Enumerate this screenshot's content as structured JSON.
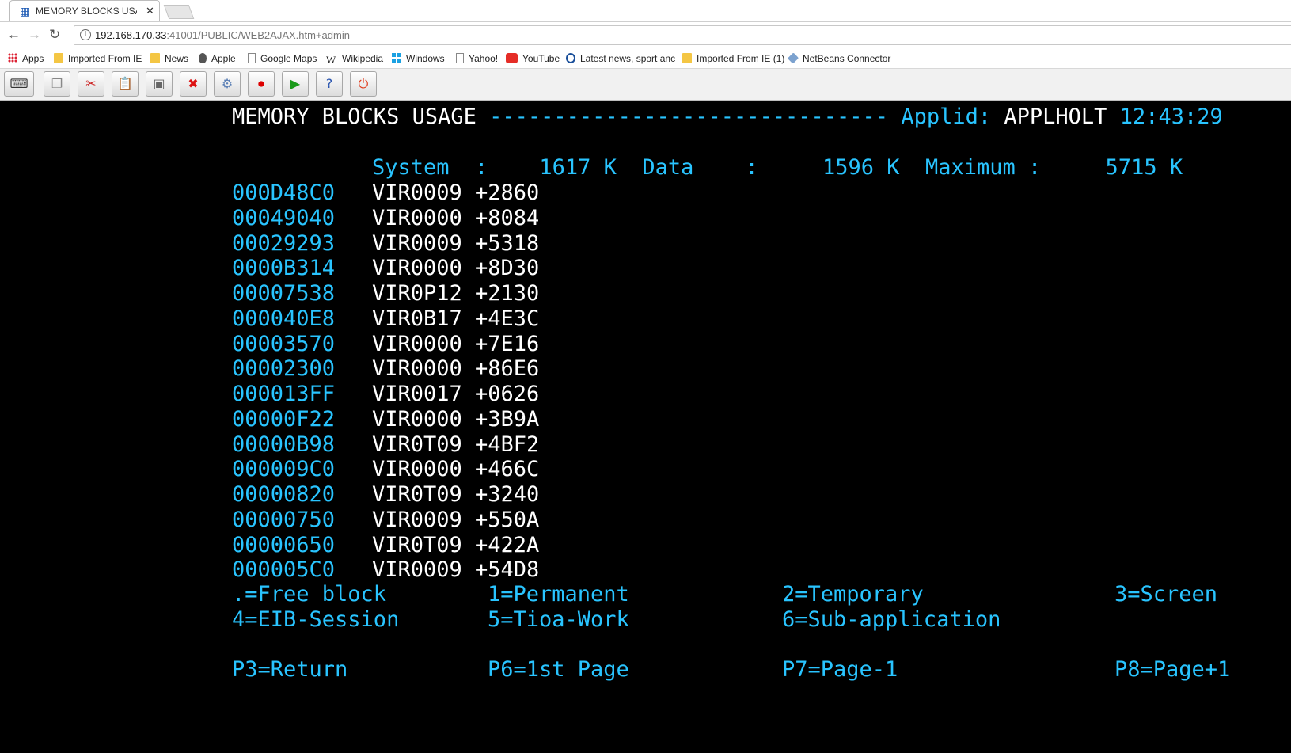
{
  "browser": {
    "tab_title": "MEMORY BLOCKS USAGE",
    "tab_close": "✕",
    "url_host": "192.168.170.33",
    "url_rest": ":41001/PUBLIC/WEB2AJAX.htm+admin",
    "bookmarks": [
      {
        "label": "Apps",
        "icon": "apps-grid-icon"
      },
      {
        "label": "Imported From IE",
        "icon": "folder-icon"
      },
      {
        "label": "News",
        "icon": "folder-icon"
      },
      {
        "label": "Apple",
        "icon": "apple-icon"
      },
      {
        "label": "Google Maps",
        "icon": "page-icon"
      },
      {
        "label": "Wikipedia",
        "icon": "wikipedia-icon"
      },
      {
        "label": "Windows",
        "icon": "windows-icon"
      },
      {
        "label": "Yahoo!",
        "icon": "page-icon"
      },
      {
        "label": "YouTube",
        "icon": "youtube-icon"
      },
      {
        "label": "Latest news, sport anc",
        "icon": "news-icon"
      },
      {
        "label": "Imported From IE (1)",
        "icon": "folder-icon"
      },
      {
        "label": "NetBeans Connector",
        "icon": "netbeans-icon"
      }
    ]
  },
  "emulator_toolbar": {
    "buttons": [
      "keyboard-icon",
      "copy-icon",
      "cut-icon",
      "paste-icon",
      "print-screen-icon",
      "disconnect-icon",
      "settings-icon",
      "record-icon",
      "play-icon",
      "help-icon",
      "power-icon"
    ]
  },
  "screen": {
    "title": "MEMORY BLOCKS USAGE",
    "dashes": "-------------------------------",
    "applid_label": "Applid:",
    "applid_value": "APPLHOLT",
    "time": "12:43:29",
    "summary": "System  :    1617 K  Data    :     1596 K  Maximum :     5715 K",
    "blocks": [
      {
        "address": "000D48C0",
        "program": "VIR0009",
        "offset": "+2860"
      },
      {
        "address": "00049040",
        "program": "VIR0000",
        "offset": "+8084"
      },
      {
        "address": "00029293",
        "program": "VIR0009",
        "offset": "+5318"
      },
      {
        "address": "0000B314",
        "program": "VIR0000",
        "offset": "+8D30"
      },
      {
        "address": "00007538",
        "program": "VIR0P12",
        "offset": "+2130"
      },
      {
        "address": "000040E8",
        "program": "VIR0B17",
        "offset": "+4E3C"
      },
      {
        "address": "00003570",
        "program": "VIR0000",
        "offset": "+7E16"
      },
      {
        "address": "00002300",
        "program": "VIR0000",
        "offset": "+86E6"
      },
      {
        "address": "000013FF",
        "program": "VIR0017",
        "offset": "+0626"
      },
      {
        "address": "00000F22",
        "program": "VIR0000",
        "offset": "+3B9A"
      },
      {
        "address": "00000B98",
        "program": "VIR0T09",
        "offset": "+4BF2"
      },
      {
        "address": "000009C0",
        "program": "VIR0000",
        "offset": "+466C"
      },
      {
        "address": "00000820",
        "program": "VIR0T09",
        "offset": "+3240"
      },
      {
        "address": "00000750",
        "program": "VIR0009",
        "offset": "+550A"
      },
      {
        "address": "00000650",
        "program": "VIR0T09",
        "offset": "+422A"
      },
      {
        "address": "000005C0",
        "program": "VIR0009",
        "offset": "+54D8"
      }
    ],
    "legend_row1": [
      ".=Free block",
      "1=Permanent",
      "2=Temporary",
      "3=Screen"
    ],
    "legend_row2": [
      "4=EIB-Session",
      "5=Tioa-Work",
      "6=Sub-application"
    ],
    "pf_keys": [
      "P3=Return",
      "P6=1st Page",
      "P7=Page-1",
      "P8=Page+1"
    ]
  }
}
